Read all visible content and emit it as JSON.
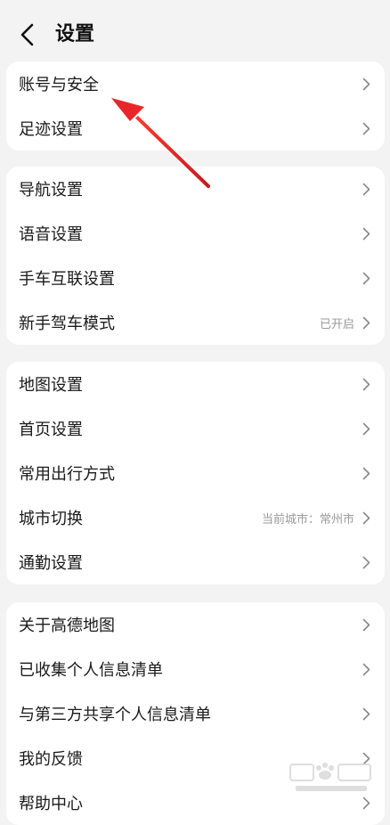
{
  "header": {
    "title": "设置",
    "back_icon": "chevron-left-icon"
  },
  "groups": [
    {
      "items": [
        {
          "label": "账号与安全",
          "value": ""
        },
        {
          "label": "足迹设置",
          "value": ""
        }
      ]
    },
    {
      "items": [
        {
          "label": "导航设置",
          "value": ""
        },
        {
          "label": "语音设置",
          "value": ""
        },
        {
          "label": "手车互联设置",
          "value": ""
        },
        {
          "label": "新手驾车模式",
          "value": "已开启"
        }
      ]
    },
    {
      "items": [
        {
          "label": "地图设置",
          "value": ""
        },
        {
          "label": "首页设置",
          "value": ""
        },
        {
          "label": "常用出行方式",
          "value": ""
        },
        {
          "label": "城市切换",
          "value": "当前城市：常州市"
        },
        {
          "label": "通勤设置",
          "value": ""
        }
      ]
    },
    {
      "items": [
        {
          "label": "关于高德地图",
          "value": ""
        },
        {
          "label": "已收集个人信息清单",
          "value": ""
        },
        {
          "label": "与第三方共享个人信息清单",
          "value": ""
        },
        {
          "label": "我的反馈",
          "value": ""
        },
        {
          "label": "帮助中心",
          "value": ""
        }
      ]
    }
  ],
  "colors": {
    "background": "#f3f3f3",
    "card": "#ffffff",
    "text": "#1a1a1a",
    "secondary_text": "#9a9a9a",
    "chevron": "#8a8a8a",
    "annotation_arrow": "#e8262a"
  },
  "icons": {
    "row_chevron": "chevron-right-icon",
    "annotation": "red-arrow-annotation",
    "watermark": "baidu-jingyan-watermark"
  }
}
